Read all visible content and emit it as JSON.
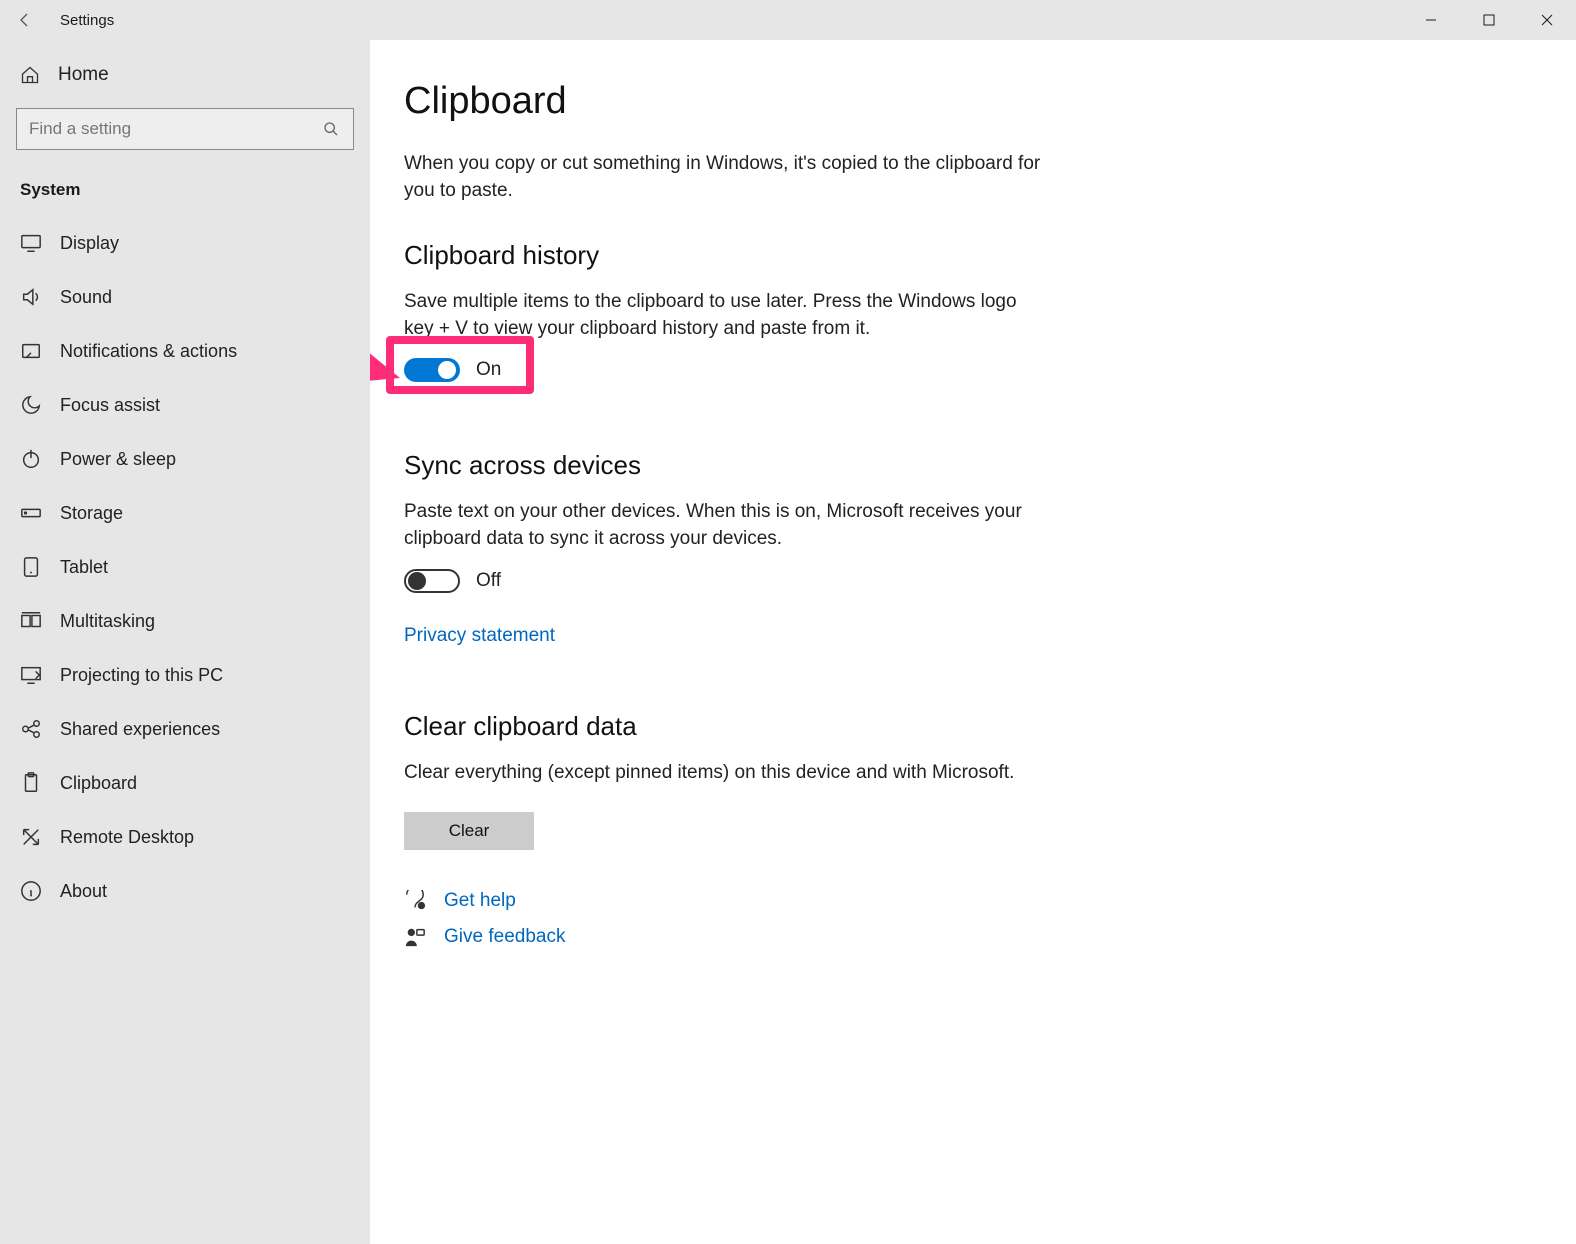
{
  "window": {
    "title": "Settings"
  },
  "sidebar": {
    "home_label": "Home",
    "search_placeholder": "Find a setting",
    "group_label": "System",
    "items": [
      {
        "id": "display",
        "label": "Display"
      },
      {
        "id": "sound",
        "label": "Sound"
      },
      {
        "id": "notifications",
        "label": "Notifications & actions"
      },
      {
        "id": "focus-assist",
        "label": "Focus assist"
      },
      {
        "id": "power-sleep",
        "label": "Power & sleep"
      },
      {
        "id": "storage",
        "label": "Storage"
      },
      {
        "id": "tablet",
        "label": "Tablet"
      },
      {
        "id": "multitasking",
        "label": "Multitasking"
      },
      {
        "id": "projecting",
        "label": "Projecting to this PC"
      },
      {
        "id": "shared-exp",
        "label": "Shared experiences"
      },
      {
        "id": "clipboard",
        "label": "Clipboard"
      },
      {
        "id": "remote-desktop",
        "label": "Remote Desktop"
      },
      {
        "id": "about",
        "label": "About"
      }
    ]
  },
  "main": {
    "title": "Clipboard",
    "intro": "When you copy or cut something in Windows, it's copied to the clipboard for you to paste.",
    "history": {
      "heading": "Clipboard history",
      "desc": "Save multiple items to the clipboard to use later. Press the Windows logo key + V to view your clipboard history and paste from it.",
      "toggle_state": "On",
      "toggle_on": true
    },
    "sync": {
      "heading": "Sync across devices",
      "desc": "Paste text on your other devices. When this is on, Microsoft receives your clipboard data to sync it across your devices.",
      "toggle_state": "Off",
      "toggle_on": false,
      "privacy_link": "Privacy statement"
    },
    "clear": {
      "heading": "Clear clipboard data",
      "desc": "Clear everything (except pinned items) on this device and with Microsoft.",
      "button": "Clear"
    },
    "help": {
      "get_help": "Get help",
      "feedback": "Give feedback"
    }
  },
  "colors": {
    "accent": "#0078d4",
    "link": "#0067c0",
    "annotation": "#ff2d78"
  }
}
